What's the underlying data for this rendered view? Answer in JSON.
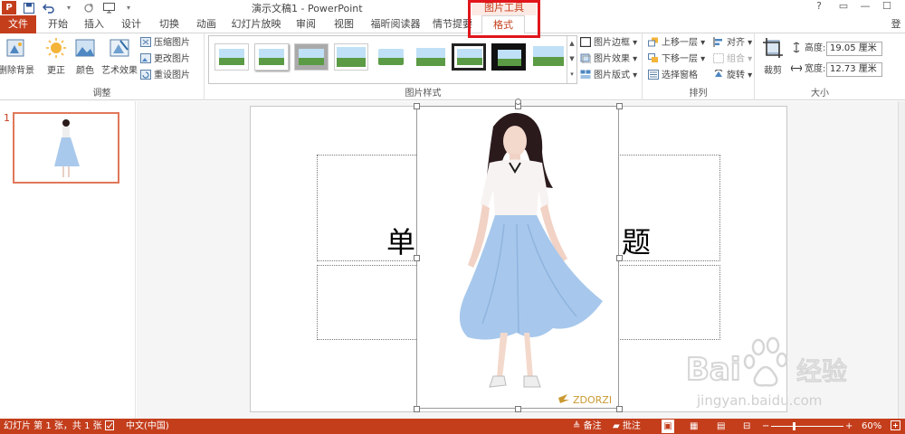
{
  "window": {
    "title": "演示文稿1 - PowerPoint",
    "context_label": "图片工具",
    "help": "?",
    "restore": "▭",
    "minimize": "—",
    "maximize": "☐",
    "close": "✕"
  },
  "tabs": {
    "file": "文件",
    "items": [
      "开始",
      "插入",
      "设计",
      "切换",
      "动画",
      "幻灯片放映",
      "审阅",
      "视图",
      "福昕阅读器",
      "情节提要"
    ],
    "format": "格式",
    "login": "登录"
  },
  "ribbon": {
    "adjust": {
      "label": "调整",
      "remove_bg": "删除背景",
      "corrections": "更正",
      "color": "颜色",
      "artistic": "艺术效果",
      "compress": "压缩图片",
      "change": "更改图片",
      "reset": "重设图片"
    },
    "styles": {
      "label": "图片样式",
      "border": "图片边框",
      "effects": "图片效果",
      "layout": "图片版式"
    },
    "arrange": {
      "label": "排列",
      "bring_forward": "上移一层",
      "send_backward": "下移一层",
      "selection_pane": "选择窗格",
      "align": "对齐",
      "group": "组合",
      "rotate": "旋转"
    },
    "size": {
      "label": "大小",
      "crop": "裁剪",
      "height_label": "高度:",
      "height_value": "19.05 厘米",
      "width_label": "宽度:",
      "width_value": "12.73 厘米"
    }
  },
  "slides_pane": {
    "number": "1"
  },
  "slide": {
    "title_left": "单",
    "title_right": "题",
    "picture_logo": "ZDORZI"
  },
  "watermark": {
    "brand": "Bai",
    "brand2": "经验",
    "url": "jingyan.baidu.com"
  },
  "statusbar": {
    "slide_info": "幻灯片 第 1 张，共 1 张",
    "language": "中文(中国)",
    "notes": "备注",
    "comments": "批注",
    "zoom": "60%"
  },
  "colors": {
    "accent": "#c43e1c",
    "highlight": "#e0161c"
  }
}
